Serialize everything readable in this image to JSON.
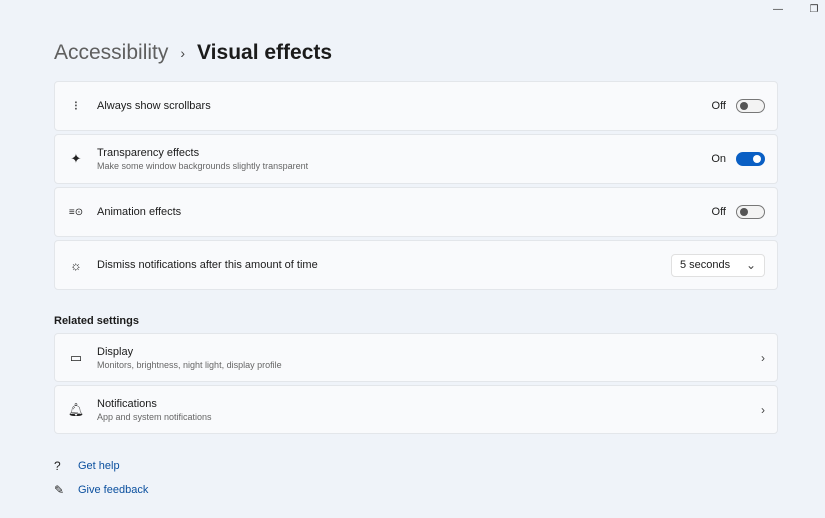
{
  "window": {
    "minimize": "—",
    "restore": "❐"
  },
  "breadcrumb": {
    "parent": "Accessibility",
    "separator": "›",
    "current": "Visual effects"
  },
  "settings": [
    {
      "icon": "scrollbar-icon",
      "glyph": "⁝",
      "title": "Always show scrollbars",
      "state": "Off",
      "on": false
    },
    {
      "icon": "transparency-icon",
      "glyph": "✦",
      "title": "Transparency effects",
      "subtitle": "Make some window backgrounds slightly transparent",
      "state": "On",
      "on": true
    },
    {
      "icon": "animation-icon",
      "glyph": "≡⊙",
      "title": "Animation effects",
      "state": "Off",
      "on": false
    },
    {
      "icon": "notification-timer-icon",
      "glyph": "☼",
      "title": "Dismiss notifications after this amount of time",
      "dropdown": "5 seconds"
    }
  ],
  "related": {
    "heading": "Related settings",
    "items": [
      {
        "icon": "display-icon",
        "glyph": "▭",
        "title": "Display",
        "subtitle": "Monitors, brightness, night light, display profile"
      },
      {
        "icon": "bell-icon",
        "glyph": "🔔︎",
        "title": "Notifications",
        "subtitle": "App and system notifications"
      }
    ]
  },
  "links": [
    {
      "icon": "help-icon",
      "glyph": "?",
      "label": "Get help"
    },
    {
      "icon": "feedback-icon",
      "glyph": "✎",
      "label": "Give feedback"
    }
  ],
  "colors": {
    "accent": "#0a5fc4",
    "background": "#eff3f9"
  }
}
